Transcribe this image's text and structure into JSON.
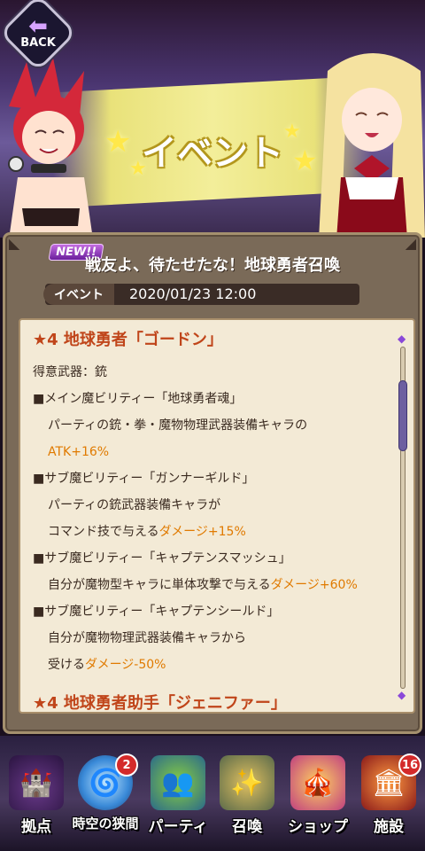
{
  "header": {
    "back_label": "BACK",
    "title": "イベント"
  },
  "event": {
    "new_badge": "NEW!!",
    "title": "戦友よ、待たせたな！地球勇者召喚",
    "date_label": "イベント",
    "date": "2020/01/23 12:00"
  },
  "content": {
    "section_title": "★4 地球勇者「ゴードン」",
    "weapon": "得意武器：銃",
    "main_ability": {
      "header": "■メイン魔ビリティー「地球勇者魂」",
      "desc": "パーティの銃・拳・魔物物理武器装備キャラの",
      "effect": "ATK+16%"
    },
    "sub1": {
      "header": "■サブ魔ビリティー「ガンナーギルド」",
      "desc1": "パーティの銃武器装備キャラが",
      "desc2": "コマンド技で与える",
      "effect": "ダメージ+15%"
    },
    "sub2": {
      "header": "■サブ魔ビリティー「キャプテンスマッシュ」",
      "desc": "自分が魔物型キャラに単体攻撃で与える",
      "effect": "ダメージ+60%"
    },
    "sub3": {
      "header": "■サブ魔ビリティー「キャプテンシールド」",
      "desc1": "自分が魔物物理武器装備キャラから",
      "desc2": "受ける",
      "effect": "ダメージ-50%"
    },
    "section_title_2": "★4 地球勇者助手「ジェニファー」"
  },
  "nav": {
    "items": [
      {
        "label": "拠点",
        "icon": "castle-icon"
      },
      {
        "label": "時空の狭間",
        "icon": "portal-icon",
        "badge": "2"
      },
      {
        "label": "パーティ",
        "icon": "party-icon"
      },
      {
        "label": "召喚",
        "icon": "summon-icon"
      },
      {
        "label": "ショップ",
        "icon": "shop-icon"
      },
      {
        "label": "施設",
        "icon": "facility-icon",
        "badge": "16"
      }
    ]
  },
  "colors": {
    "accent_title": "#c0451a",
    "highlight": "#e07a00",
    "panel_bg": "#7a6a58",
    "content_bg": "#f3ead6"
  }
}
